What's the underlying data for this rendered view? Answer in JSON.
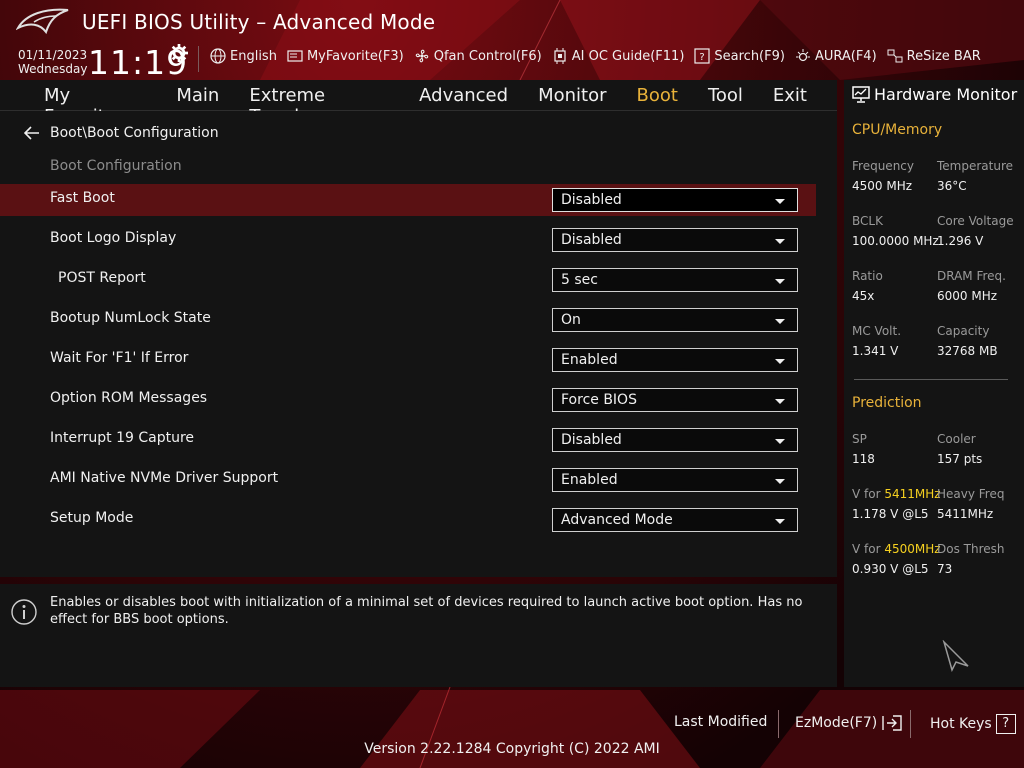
{
  "app": {
    "title": "UEFI BIOS Utility – Advanced Mode"
  },
  "status": {
    "date": "01/11/2023",
    "day": "Wednesday",
    "time": "11:19"
  },
  "toolbar": {
    "items": [
      {
        "label": "English",
        "icon": "globe-icon"
      },
      {
        "label": "MyFavorite(F3)",
        "icon": "favorite-icon"
      },
      {
        "label": "Qfan Control(F6)",
        "icon": "fan-icon"
      },
      {
        "label": "AI OC Guide(F11)",
        "icon": "chip-icon"
      },
      {
        "label": "Search(F9)",
        "icon": "search-icon"
      },
      {
        "label": "AURA(F4)",
        "icon": "aura-icon"
      },
      {
        "label": "ReSize BAR",
        "icon": "resize-bar-icon"
      }
    ]
  },
  "nav": {
    "tabs": [
      "My Favorites",
      "Main",
      "Extreme Tweaker",
      "Advanced",
      "Monitor",
      "Boot",
      "Tool",
      "Exit"
    ],
    "active": "Boot"
  },
  "page": {
    "breadcrumb": "Boot\\Boot Configuration",
    "section": "Boot Configuration",
    "settings": [
      {
        "label": "Fast Boot",
        "value": "Disabled",
        "selected": true
      },
      {
        "label": "Boot Logo Display",
        "value": "Disabled"
      },
      {
        "label": "POST Report",
        "value": "5 sec",
        "indent": true
      },
      {
        "label": "Bootup NumLock State",
        "value": "On"
      },
      {
        "label": "Wait For 'F1' If Error",
        "value": "Enabled"
      },
      {
        "label": "Option ROM Messages",
        "value": "Force BIOS"
      },
      {
        "label": "Interrupt 19 Capture",
        "value": "Disabled"
      },
      {
        "label": "AMI Native NVMe Driver Support",
        "value": "Enabled"
      },
      {
        "label": "Setup Mode",
        "value": "Advanced Mode"
      }
    ]
  },
  "help": {
    "text": "Enables or disables boot with initialization of a minimal set of devices required to launch active boot option. Has no effect for BBS boot options."
  },
  "hw_monitor": {
    "title": "Hardware Monitor",
    "cpu_memory": {
      "heading": "CPU/Memory",
      "items": [
        {
          "label": "Frequency",
          "value": "4500 MHz"
        },
        {
          "label": "Temperature",
          "value": "36°C"
        },
        {
          "label": "BCLK",
          "value": "100.0000 MHz"
        },
        {
          "label": "Core Voltage",
          "value": "1.296 V"
        },
        {
          "label": "Ratio",
          "value": "45x"
        },
        {
          "label": "DRAM Freq.",
          "value": "6000 MHz"
        },
        {
          "label": "MC Volt.",
          "value": "1.341 V"
        },
        {
          "label": "Capacity",
          "value": "32768 MB"
        }
      ]
    },
    "prediction": {
      "heading": "Prediction",
      "sp_label": "SP",
      "sp_value": "118",
      "cooler_label": "Cooler",
      "cooler_value": "157 pts",
      "v1_prefix": "V for ",
      "v1_freq": "5411MHz",
      "v1_value": "1.178 V @L5",
      "heavy_label": "Heavy Freq",
      "heavy_value": "5411MHz",
      "v2_prefix": "V for ",
      "v2_freq": "4500MHz",
      "v2_value": "0.930 V @L5",
      "dos_label": "Dos Thresh",
      "dos_value": "73"
    }
  },
  "footer": {
    "last_modified": "Last Modified",
    "ezmode": "EzMode(F7)",
    "hotkeys": "Hot Keys",
    "hotkeys_icon": "?",
    "version": "Version 2.22.1284 Copyright (C) 2022 AMI"
  },
  "colors": {
    "accent": "#e8b23a",
    "highlight_row": "#5a1113",
    "highlight_freq": "#f5d020"
  }
}
